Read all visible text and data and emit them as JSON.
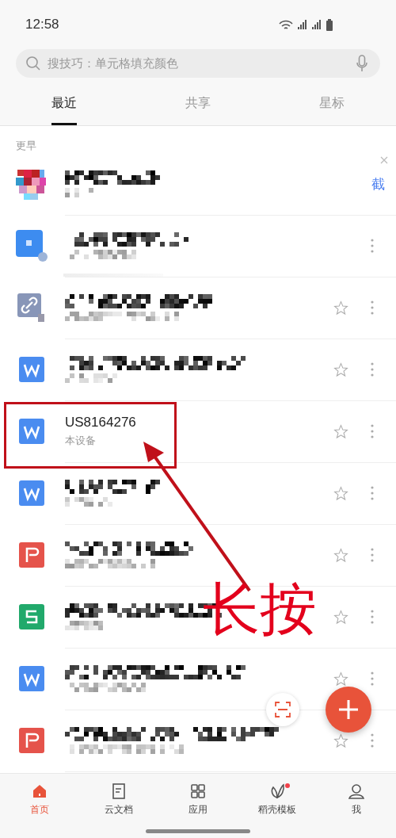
{
  "status_bar": {
    "time": "12:58"
  },
  "search": {
    "placeholder": "搜技巧：单元格填充颜色"
  },
  "tabs": [
    {
      "label": "最近",
      "selected": true
    },
    {
      "label": "共享",
      "selected": false
    },
    {
      "label": "星标",
      "selected": false
    }
  ],
  "section_label": "更早",
  "files": [
    {
      "kind": "avatar",
      "action_text": "截"
    },
    {
      "kind": "doc",
      "level": 0.3
    },
    {
      "kind": "link",
      "starred": false
    },
    {
      "kind": "writer",
      "starred": false
    },
    {
      "kind": "writer",
      "title": "US8164276",
      "subtitle": "本设备",
      "starred": false
    },
    {
      "kind": "writer",
      "starred": false
    },
    {
      "kind": "pdf",
      "starred": false
    },
    {
      "kind": "sheet",
      "starred": false
    },
    {
      "kind": "writer",
      "starred": false
    },
    {
      "kind": "pdf",
      "starred": false
    }
  ],
  "annotation": {
    "label": "长按"
  },
  "bottom_nav": [
    {
      "label": "首页",
      "kind": "home",
      "selected": true
    },
    {
      "label": "云文档",
      "kind": "doc",
      "selected": false
    },
    {
      "label": "应用",
      "kind": "grid",
      "selected": false
    },
    {
      "label": "稻壳模板",
      "kind": "leaf",
      "selected": false,
      "badge": true
    },
    {
      "label": "我",
      "kind": "person",
      "selected": false
    }
  ]
}
